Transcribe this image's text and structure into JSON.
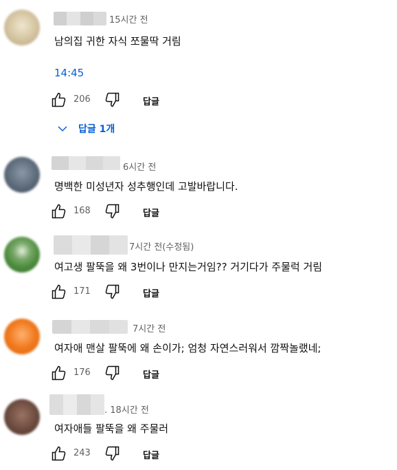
{
  "comments": [
    {
      "time": "15시간 전",
      "text": "남의집 귀한 자식 쪼물딱 거림",
      "timestamp_link": "14:45",
      "likes": "206",
      "reply_label": "답글",
      "replies_toggle": "답글 1개",
      "avatar_color": "#d7c9a8"
    },
    {
      "time": "6시간 전",
      "text": "명백한 미성년자 성추행인데 고발바랍니다.",
      "likes": "168",
      "reply_label": "답글",
      "avatar_color": "#5c6b7a"
    },
    {
      "time": "7시간 전(수정됨)",
      "text": "여고생 팔뚝을 왜 3번이나  만지는거임?? 거기다가 주물럭 거림",
      "likes": "171",
      "reply_label": "답글",
      "avatar_color": "#4b8a3b"
    },
    {
      "time": "7시간 전",
      "text": "여자애 맨살 팔뚝에 왜 손이가; 엄청 자연스러워서 깜짝놀랬네;",
      "likes": "176",
      "reply_label": "답글",
      "avatar_color": "#f07a1e"
    },
    {
      "time": ". 18시간 전",
      "text": "여자애들 팔뚝을 왜 주물러",
      "likes": "243",
      "reply_label": "답글",
      "avatar_color": "#6b4a3e"
    }
  ]
}
